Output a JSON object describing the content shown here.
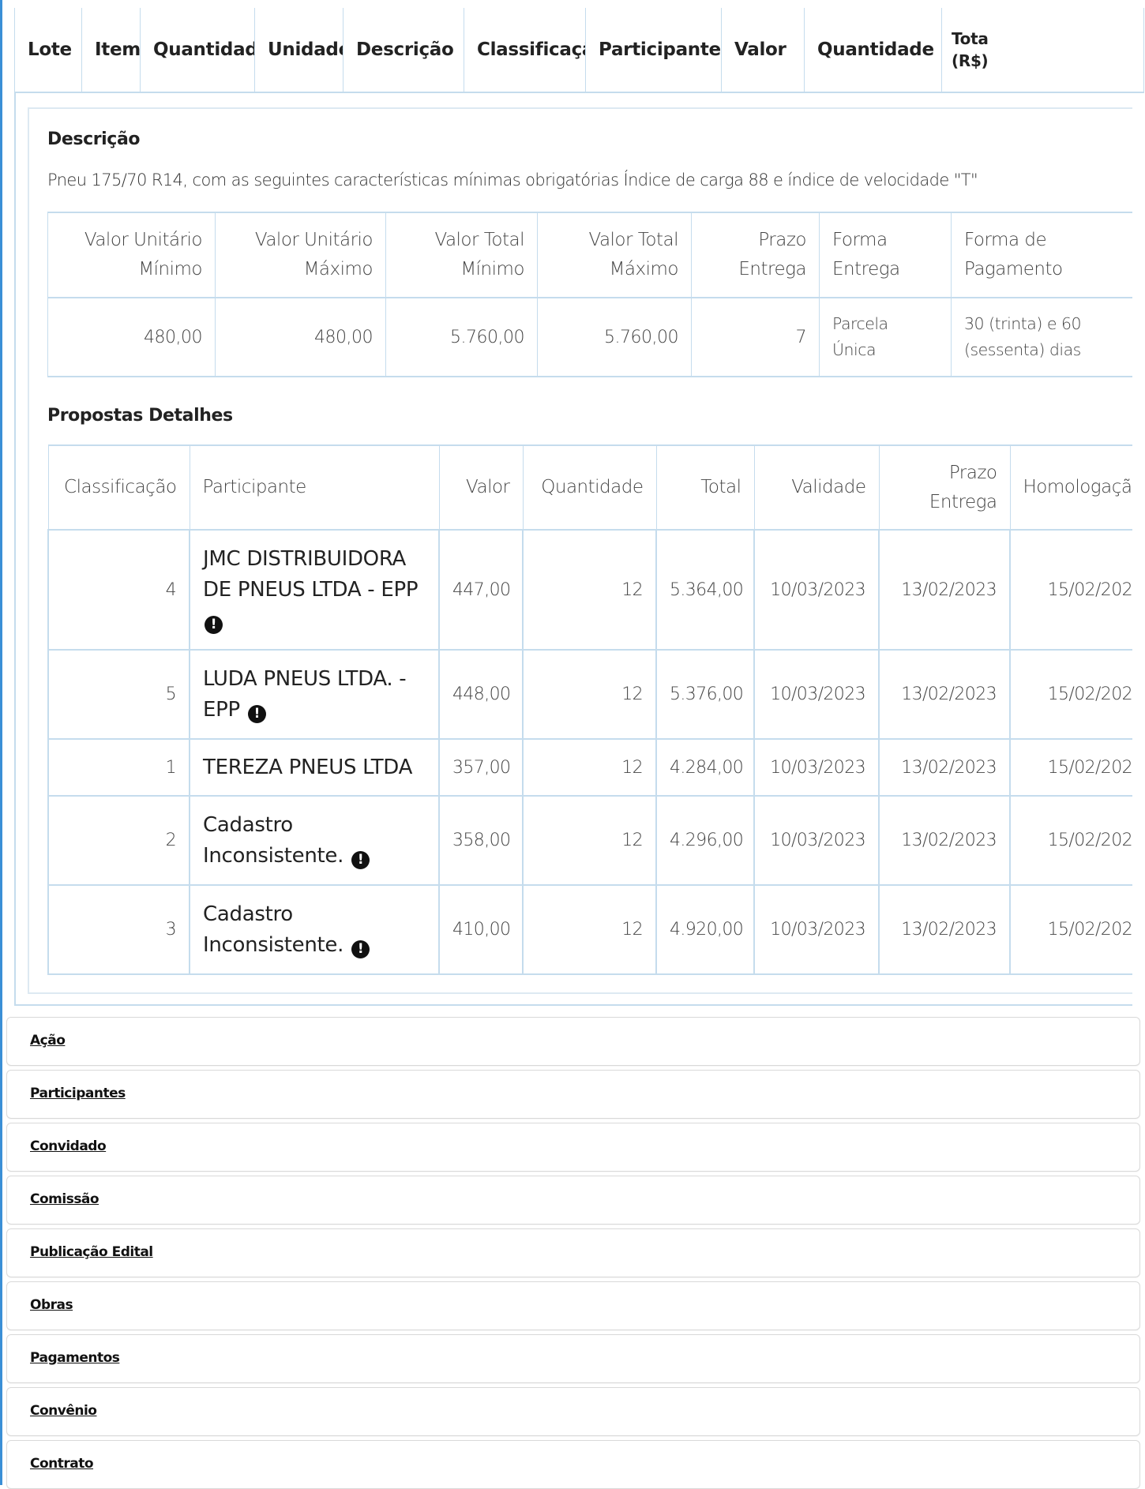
{
  "header_columns": [
    "Lote",
    "Item",
    "Quantidade",
    "Unidade",
    "Descrição",
    "Classificação",
    "Participante",
    "Valor",
    "Quantidade",
    "Tota",
    "(R$)"
  ],
  "descricao": {
    "title": "Descrição",
    "text": "Pneu 175/70 R14, com as seguintes características mínimas obrigatórias Índice de carga 88 e índice de velocidade \"T\""
  },
  "valores": {
    "headers": [
      [
        "Valor Unitário",
        "Mínimo"
      ],
      [
        "Valor Unitário",
        "Máximo"
      ],
      [
        "Valor Total",
        "Mínimo"
      ],
      [
        "Valor Total",
        "Máximo"
      ],
      [
        "Prazo",
        "Entrega"
      ],
      [
        "Forma",
        "Entrega"
      ],
      [
        "Forma de",
        "Pagamento"
      ]
    ],
    "row": [
      "480,00",
      "480,00",
      "5.760,00",
      "5.760,00",
      "7",
      [
        "Parcela",
        "Única"
      ],
      [
        "30 (trinta) e 60",
        "(sessenta) dias"
      ]
    ]
  },
  "propostas": {
    "title": "Propostas Detalhes",
    "headers": [
      "Classificação",
      "Participante",
      "Valor",
      "Quantidade",
      "Total",
      "Validade",
      [
        "Prazo",
        "Entrega"
      ],
      "Homologaçã"
    ],
    "rows": [
      {
        "classificacao": "4",
        "participante": "JMC DISTRIBUIDORA DE PNEUS LTDA - EPP",
        "warning": true,
        "valor": "447,00",
        "quantidade": "12",
        "total": "5.364,00",
        "validade": "10/03/2023",
        "prazo": "13/02/2023",
        "homologacao": "15/02/202"
      },
      {
        "classificacao": "5",
        "participante": "LUDA PNEUS LTDA. - EPP",
        "warning": true,
        "valor": "448,00",
        "quantidade": "12",
        "total": "5.376,00",
        "validade": "10/03/2023",
        "prazo": "13/02/2023",
        "homologacao": "15/02/202"
      },
      {
        "classificacao": "1",
        "participante": "TEREZA PNEUS LTDA",
        "warning": false,
        "valor": "357,00",
        "quantidade": "12",
        "total": "4.284,00",
        "validade": "10/03/2023",
        "prazo": "13/02/2023",
        "homologacao": "15/02/202"
      },
      {
        "classificacao": "2",
        "participante": "Cadastro Inconsistente.",
        "warning": true,
        "valor": "358,00",
        "quantidade": "12",
        "total": "4.296,00",
        "validade": "10/03/2023",
        "prazo": "13/02/2023",
        "homologacao": "15/02/202"
      },
      {
        "classificacao": "3",
        "participante": "Cadastro Inconsistente.",
        "warning": true,
        "valor": "410,00",
        "quantidade": "12",
        "total": "4.920,00",
        "validade": "10/03/2023",
        "prazo": "13/02/2023",
        "homologacao": "15/02/202"
      }
    ]
  },
  "warning_icon": "exclamation-circle-icon",
  "accordion": [
    "Ação",
    "Participantes",
    "Convidado",
    "Comissão",
    "Publicação Edital",
    "Obras",
    "Pagamentos",
    "Convênio",
    "Contrato"
  ]
}
